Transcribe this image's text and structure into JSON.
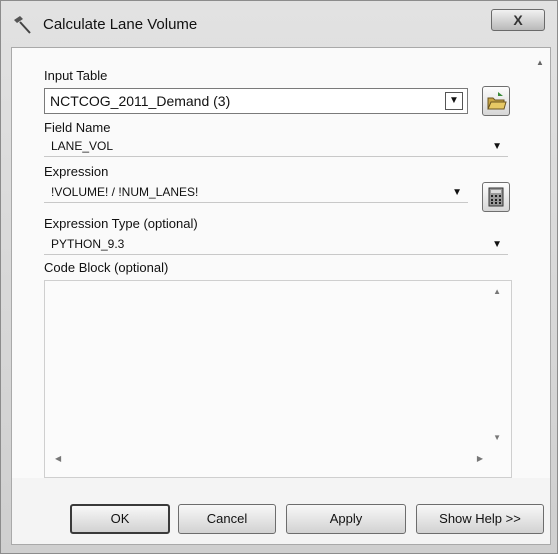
{
  "window": {
    "title": "Calculate Lane Volume",
    "close_label": "X"
  },
  "form": {
    "input_table": {
      "label": "Input Table",
      "value": "NCTCOG_2011_Demand (3)"
    },
    "field_name": {
      "label": "Field Name",
      "value": "LANE_VOL"
    },
    "expression": {
      "label": "Expression",
      "value": "!VOLUME! / !NUM_LANES!"
    },
    "expression_type": {
      "label": "Expression Type (optional)",
      "value": "PYTHON_9.3"
    },
    "code_block": {
      "label": "Code Block (optional)",
      "value": ""
    }
  },
  "buttons": {
    "ok": "OK",
    "cancel": "Cancel",
    "apply": "Apply",
    "show_help": "Show Help >>"
  },
  "icons": {
    "window_icon": "hammer-icon",
    "browse_icon": "folder-open-icon",
    "calculator_icon": "calculator-icon"
  }
}
